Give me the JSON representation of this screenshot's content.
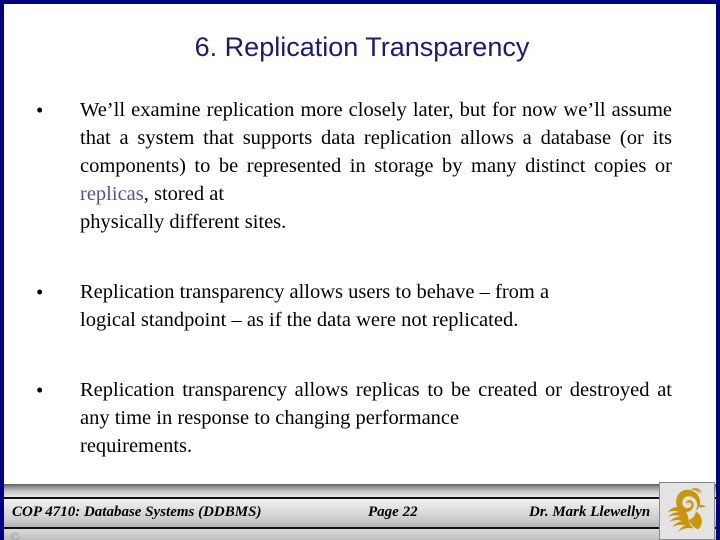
{
  "slide": {
    "title": "6. Replication Transparency",
    "title_color": "#1a1a78",
    "border_color": "#000080",
    "background_color": "#ffffff",
    "bullet_marker": "•",
    "highlight_color": "#55519b"
  },
  "bullets": [
    {
      "marker": "•",
      "segments": [
        {
          "text": "We’ll examine replication more closely later, but for now we’ll assume that a system that supports data replication allows a database (or its components) to be represented in storage by many distinct copies or ",
          "style": "normal"
        },
        {
          "text": "replicas",
          "style": "highlight"
        },
        {
          "text": ", stored at ",
          "style": "normal"
        }
      ],
      "last_line": "physically different sites."
    },
    {
      "marker": "•",
      "segments": [
        {
          "text": "Replication transparency allows users to behave – from a ",
          "style": "normal"
        }
      ],
      "last_line": "logical standpoint – as if the data were not replicated."
    },
    {
      "marker": "•",
      "segments": [
        {
          "text": "Replication transparency allows replicas to be created or destroyed at any time in response to changing performance ",
          "style": "normal"
        }
      ],
      "last_line": "requirements."
    }
  ],
  "footer": {
    "course": "COP 4710: Database Systems  (DDBMS)",
    "page": "Page 22",
    "author": "Dr. Mark Llewellyn",
    "copyright": "©",
    "logo_name": "ucf-pegasus-logo",
    "logo_color": "#c8960c"
  }
}
